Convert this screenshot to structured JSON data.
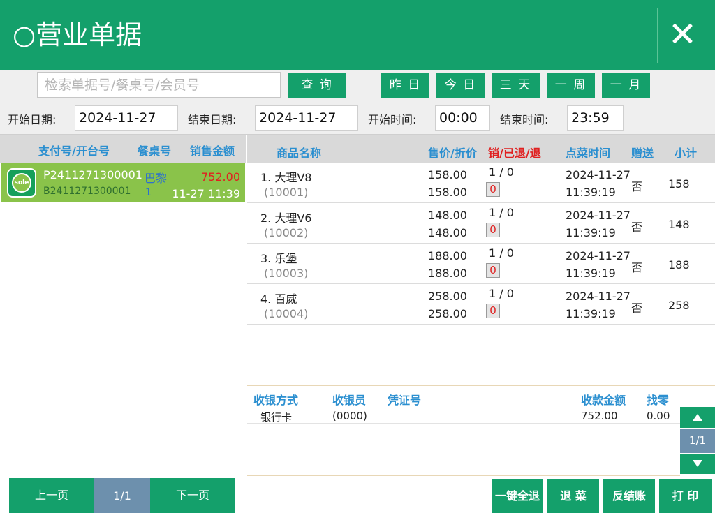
{
  "title": "○营业单据",
  "filters": {
    "search_placeholder": "检索单据号/餐桌号/会员号",
    "query_label": "查 询",
    "quick": [
      "昨 日",
      "今 日",
      "三 天",
      "一 周",
      "一 月"
    ],
    "start_date_label": "开始日期:",
    "start_date": "2024-11-27",
    "end_date_label": "结束日期:",
    "end_date": "2024-11-27",
    "start_time_label": "开始时间:",
    "start_time": "00:00",
    "end_time_label": "结束时间:",
    "end_time": "23:59"
  },
  "orders": {
    "headers": [
      "支付号/开台号",
      "餐桌号",
      "销售金额"
    ],
    "rows": [
      {
        "icon_text": "sole",
        "pay_no": "P2411271300001",
        "open_no": "B2411271300001",
        "table": "巴黎",
        "table_count": "1",
        "amount": "752.00",
        "time": "11-27 11:39"
      }
    ],
    "pager": {
      "prev": "上一页",
      "page": "1/1",
      "next": "下一页"
    }
  },
  "items": {
    "headers": [
      "商品名称",
      "售价/折价",
      "销/已退/退",
      "点菜时间",
      "赠送",
      "小计"
    ],
    "rows": [
      {
        "name": "1. 大理V8",
        "code": "(10001)",
        "price": "158.00",
        "disc_price": "158.00",
        "qty": "1 / 0",
        "return_qty": "0",
        "date": "2024-11-27",
        "time": "11:39:19",
        "gift": "否",
        "subtotal": "158"
      },
      {
        "name": "2. 大理V6",
        "code": "(10002)",
        "price": "148.00",
        "disc_price": "148.00",
        "qty": "1 / 0",
        "return_qty": "0",
        "date": "2024-11-27",
        "time": "11:39:19",
        "gift": "否",
        "subtotal": "148"
      },
      {
        "name": "3. 乐堡",
        "code": "(10003)",
        "price": "188.00",
        "disc_price": "188.00",
        "qty": "1 / 0",
        "return_qty": "0",
        "date": "2024-11-27",
        "time": "11:39:19",
        "gift": "否",
        "subtotal": "188"
      },
      {
        "name": "4. 百威",
        "code": "(10004)",
        "price": "258.00",
        "disc_price": "258.00",
        "qty": "1 / 0",
        "return_qty": "0",
        "date": "2024-11-27",
        "time": "11:39:19",
        "gift": "否",
        "subtotal": "258"
      }
    ]
  },
  "payments": {
    "headers": [
      "收银方式",
      "收银员",
      "凭证号",
      "收款金额",
      "找零"
    ],
    "rows": [
      {
        "method": "银行卡",
        "cashier": "(0000)",
        "voucher": "",
        "amount": "752.00",
        "change": "0.00"
      }
    ],
    "page": "1/1"
  },
  "actions": [
    "一键全退",
    "退 菜",
    "反结账",
    "打 印"
  ],
  "colors": {
    "brand_green": "#14a06b",
    "selected_row": "#8ac34a",
    "header_blue": "#2b8fd0",
    "alert_red": "#e02020",
    "pager_blue": "#6d90ad"
  }
}
